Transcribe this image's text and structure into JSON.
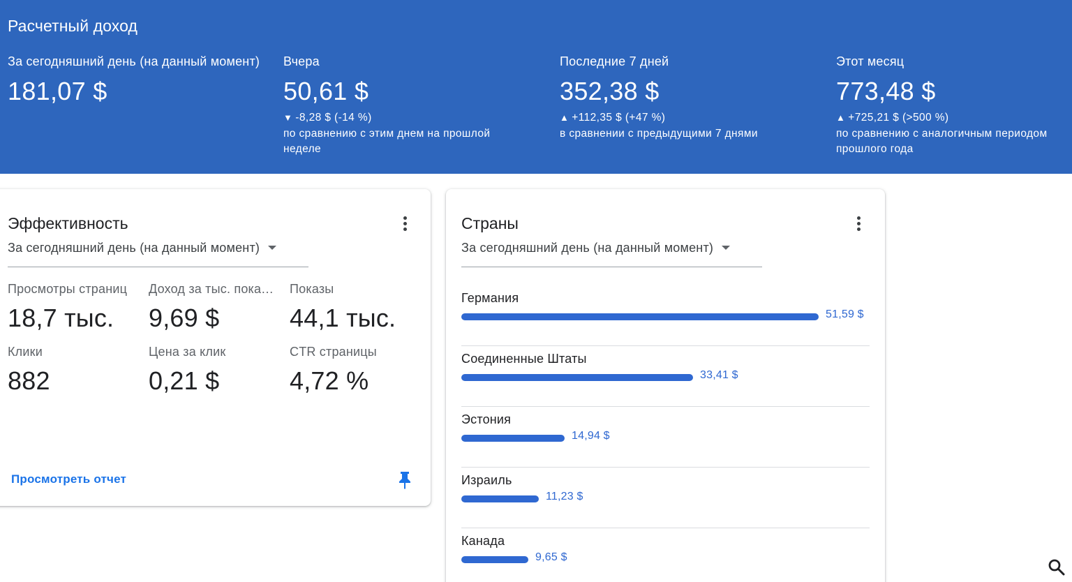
{
  "banner": {
    "title": "Расчетный доход",
    "metrics": [
      {
        "label": "За сегодняшний день (на данный момент)",
        "value": "181,07 $",
        "change": "",
        "compare": ""
      },
      {
        "label": "Вчера",
        "value": "50,61 $",
        "direction": "down",
        "change": "-8,28 $ (-14 %)",
        "compare": "по сравнению с этим днем на прошлой неделе"
      },
      {
        "label": "Последние 7 дней",
        "value": "352,38 $",
        "direction": "up",
        "change": "+112,35 $ (+47 %)",
        "compare": "в сравнении с предыдущими 7 днями"
      },
      {
        "label": "Этот месяц",
        "value": "773,48 $",
        "direction": "up",
        "change": "+725,21 $ (>500 %)",
        "compare": "по сравнению с аналогичным периодом прошлого года"
      }
    ],
    "arrow_down": "▼",
    "arrow_up": "▲",
    "colors": {
      "background": "#2e66bd",
      "text": "#ffffff"
    }
  },
  "performance": {
    "title": "Эффективность",
    "period": "За сегодняшний день (на данный момент)",
    "stats": [
      {
        "label": "Просмотры страниц",
        "value": "18,7 тыс."
      },
      {
        "label": "Доход за тыс. показов",
        "value": "9,69 $"
      },
      {
        "label": "Показы",
        "value": "44,1 тыс."
      },
      {
        "label": "Клики",
        "value": "882"
      },
      {
        "label": "Цена за клик",
        "value": "0,21 $"
      },
      {
        "label": "CTR страницы",
        "value": "4,72 %"
      }
    ],
    "report_link": "Просмотреть отчет",
    "menu_icon": "more-vert-icon",
    "pin_icon": "pin-icon"
  },
  "countries": {
    "title": "Страны",
    "period": "За сегодняшний день (на данный момент)",
    "max_value": 51.59,
    "rows": [
      {
        "name": "Германия",
        "value": "51,59 $",
        "amount": 51.59
      },
      {
        "name": "Соединенные Штаты",
        "value": "33,41 $",
        "amount": 33.41
      },
      {
        "name": "Эстония",
        "value": "14,94 $",
        "amount": 14.94
      },
      {
        "name": "Израиль",
        "value": "11,23 $",
        "amount": 11.23
      },
      {
        "name": "Канада",
        "value": "9,65 $",
        "amount": 9.65
      }
    ],
    "bar_color": "#2f68d1",
    "menu_icon": "more-vert-icon"
  },
  "floating": {
    "search_icon": "search-icon"
  }
}
